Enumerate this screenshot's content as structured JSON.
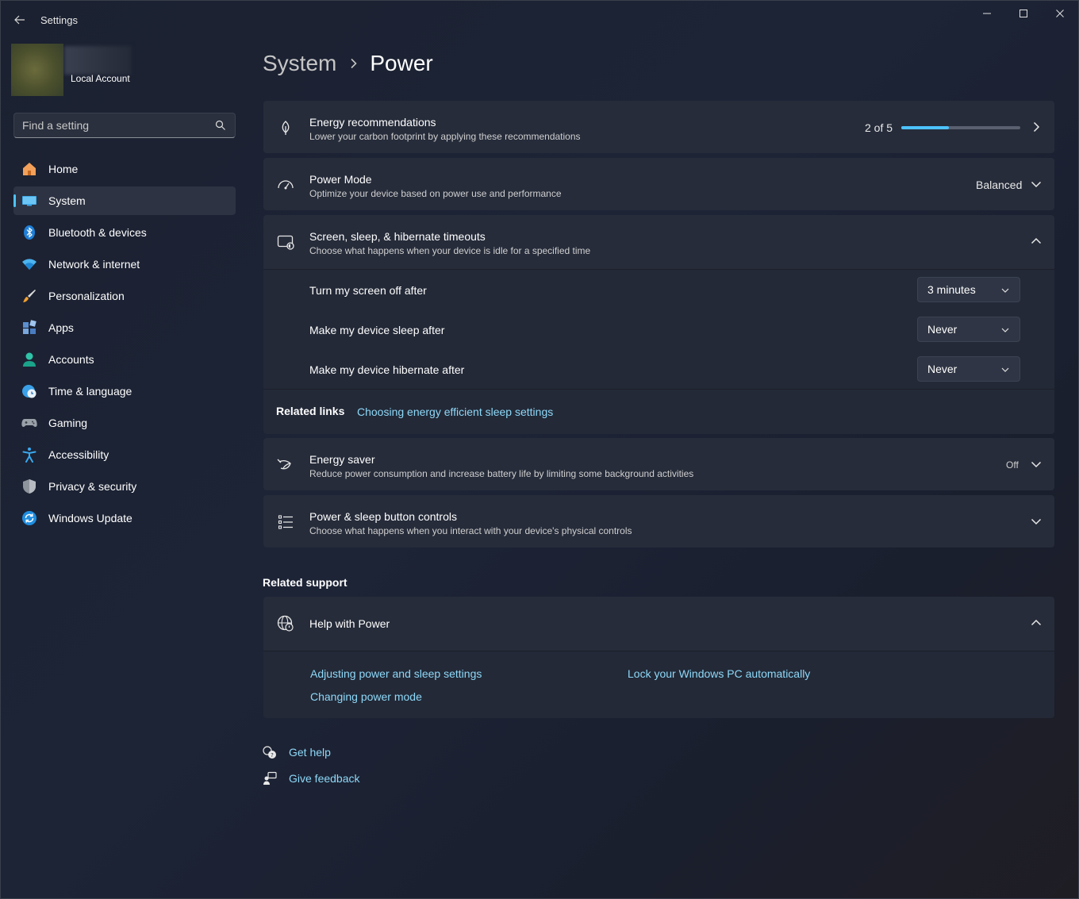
{
  "window": {
    "title": "Settings"
  },
  "profile": {
    "account_type": "Local Account"
  },
  "search": {
    "placeholder": "Find a setting"
  },
  "sidebar": {
    "items": [
      {
        "label": "Home",
        "icon": "home-icon",
        "active": false
      },
      {
        "label": "System",
        "icon": "system-icon",
        "active": true
      },
      {
        "label": "Bluetooth & devices",
        "icon": "bluetooth-icon",
        "active": false
      },
      {
        "label": "Network & internet",
        "icon": "wifi-icon",
        "active": false
      },
      {
        "label": "Personalization",
        "icon": "brush-icon",
        "active": false
      },
      {
        "label": "Apps",
        "icon": "apps-icon",
        "active": false
      },
      {
        "label": "Accounts",
        "icon": "person-icon",
        "active": false
      },
      {
        "label": "Time & language",
        "icon": "globe-clock-icon",
        "active": false
      },
      {
        "label": "Gaming",
        "icon": "controller-icon",
        "active": false
      },
      {
        "label": "Accessibility",
        "icon": "accessibility-icon",
        "active": false
      },
      {
        "label": "Privacy & security",
        "icon": "shield-icon",
        "active": false
      },
      {
        "label": "Windows Update",
        "icon": "update-icon",
        "active": false
      }
    ]
  },
  "breadcrumb": {
    "parent": "System",
    "current": "Power"
  },
  "energy_recommendations": {
    "title": "Energy recommendations",
    "subtitle": "Lower your carbon footprint by applying these recommendations",
    "progress_text": "2 of 5",
    "progress_fraction": 0.4
  },
  "power_mode": {
    "title": "Power Mode",
    "subtitle": "Optimize your device based on power use and performance",
    "value": "Balanced"
  },
  "timeouts": {
    "title": "Screen, sleep, & hibernate timeouts",
    "subtitle": "Choose what happens when your device is idle for a specified time",
    "settings": [
      {
        "label": "Turn my screen off after",
        "value": "3 minutes"
      },
      {
        "label": "Make my device sleep after",
        "value": "Never"
      },
      {
        "label": "Make my device hibernate after",
        "value": "Never"
      }
    ],
    "related_links_label": "Related links",
    "related_link": "Choosing energy efficient sleep settings"
  },
  "energy_saver": {
    "title": "Energy saver",
    "subtitle": "Reduce power consumption and increase battery life by limiting some background activities",
    "state": "Off"
  },
  "button_controls": {
    "title": "Power & sleep button controls",
    "subtitle": "Choose what happens when you interact with your device's physical controls"
  },
  "related_support": {
    "heading": "Related support",
    "help_title": "Help with Power",
    "links": [
      "Adjusting power and sleep settings",
      "Changing power mode",
      "Lock your Windows PC automatically"
    ]
  },
  "footer": {
    "get_help": "Get help",
    "give_feedback": "Give feedback"
  },
  "colors": {
    "accent": "#4cc2ff",
    "link": "#8ed8f8",
    "card": "#262c3a"
  }
}
